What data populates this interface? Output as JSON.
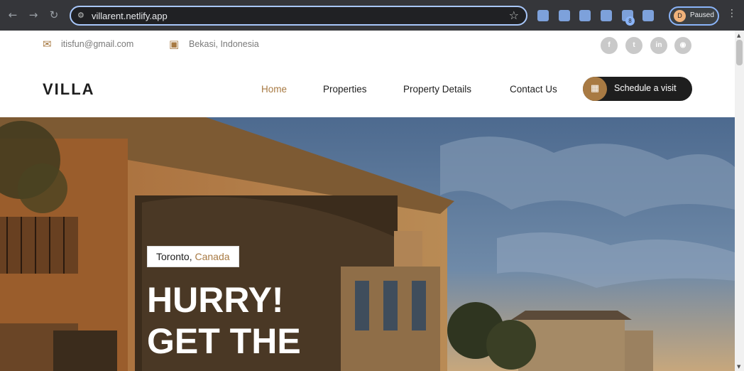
{
  "browser": {
    "url": "villarent.netlify.app",
    "profile_initial": "D",
    "profile_status": "Paused",
    "extension_badge": "8"
  },
  "topbar": {
    "email": "itisfun@gmail.com",
    "location": "Bekasi, Indonesia",
    "socials": [
      "facebook-icon",
      "twitter-icon",
      "linkedin-icon",
      "instagram-icon"
    ]
  },
  "header": {
    "logo": "VILLA",
    "nav": [
      "Home",
      "Properties",
      "Property Details",
      "Contact Us"
    ],
    "cta_label": "Schedule a visit"
  },
  "hero": {
    "city": "Toronto,",
    "country": "Canada",
    "headline_line1": "HURRY!",
    "headline_line2": "GET THE"
  },
  "colors": {
    "accent": "#a87a43",
    "dark": "#1e1e1e",
    "chrome": "#35363a"
  }
}
